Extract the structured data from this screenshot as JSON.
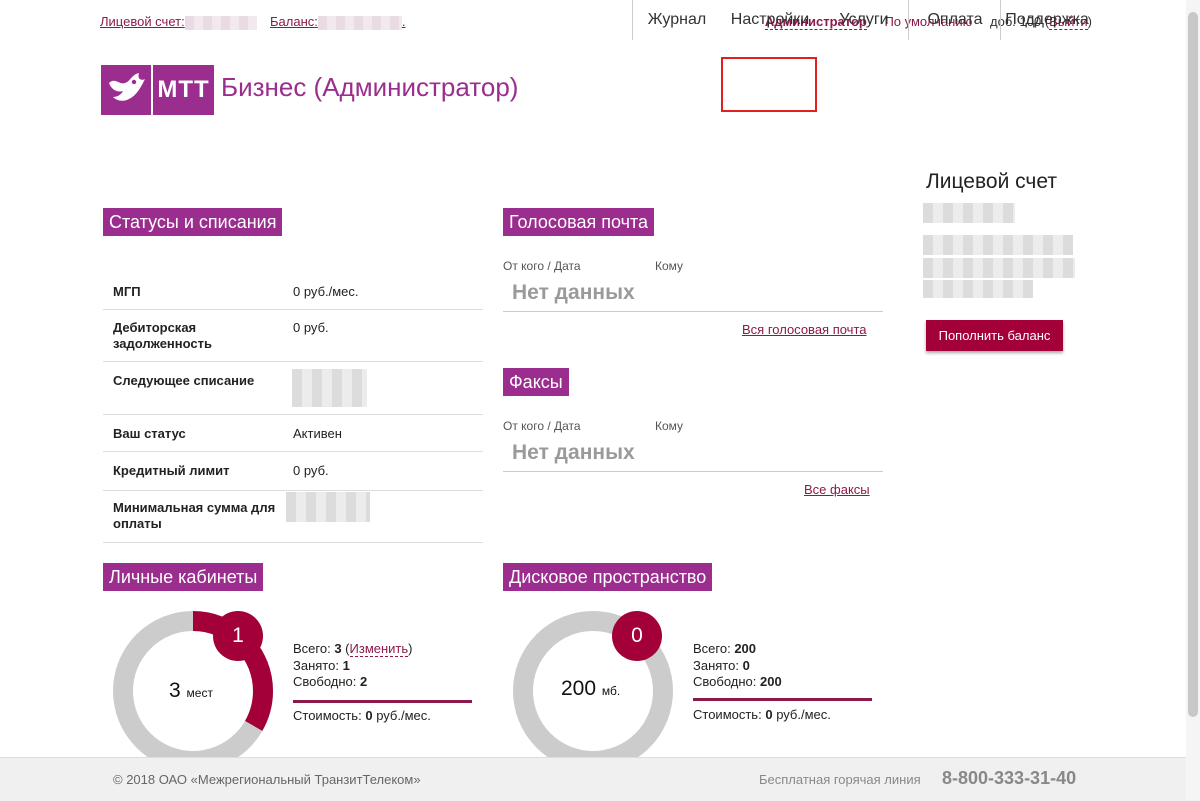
{
  "topbar": {
    "account_label": "Лицевой счет:",
    "balance_label": "Баланс:",
    "balance_suffix": ".",
    "user": "Администратор",
    "profile": "По умолчанию",
    "ext": "доб. 100",
    "logout": "Выйти"
  },
  "header": {
    "logo_text": "МТТ",
    "brand": "Бизнес (Администратор)",
    "nav": [
      {
        "label": "Журнал"
      },
      {
        "label": "Настройки"
      },
      {
        "label": "Услуги"
      },
      {
        "label": "Оплата"
      },
      {
        "label": "Поддержка"
      }
    ]
  },
  "statuses": {
    "title": "Статусы и списания",
    "rows": [
      {
        "k": "МГП",
        "v": "0 руб./мес."
      },
      {
        "k": "Дебиторская задолженность",
        "v": "0 руб."
      },
      {
        "k": "Следующее списание",
        "v": ""
      },
      {
        "k": "Ваш статус",
        "v": "Активен"
      },
      {
        "k": "Кредитный лимит",
        "v": "0 руб."
      },
      {
        "k": "Минимальная сумма для оплаты",
        "v": ""
      }
    ]
  },
  "voicemail": {
    "title": "Голосовая почта",
    "col_from": "От кого / Дата",
    "col_to": "Кому",
    "empty": "Нет данных",
    "all_link": "Вся голосовая почта"
  },
  "faxes": {
    "title": "Факсы",
    "col_from": "От кого / Дата",
    "col_to": "Кому",
    "empty": "Нет данных",
    "all_link": "Все факсы"
  },
  "account": {
    "title": "Лицевой счет",
    "button": "Пополнить баланс"
  },
  "cabinets": {
    "title": "Личные кабинеты",
    "badge": "1",
    "center_value": "3",
    "center_unit": "мест",
    "total_label": "Всего:",
    "total": "3",
    "change_link": "Изменить",
    "busy_label": "Занято:",
    "busy": "1",
    "free_label": "Свободно:",
    "free": "2",
    "cost_label": "Стоимость:",
    "cost_value": "0",
    "cost_unit": "руб./мес.",
    "used_fraction": 0.333,
    "accent": "#a3003a"
  },
  "disk": {
    "title": "Дисковое пространство",
    "badge": "0",
    "center_value": "200",
    "center_unit": "мб.",
    "total_label": "Всего:",
    "total": "200",
    "busy_label": "Занято:",
    "busy": "0",
    "free_label": "Свободно:",
    "free": "200",
    "cost_label": "Стоимость:",
    "cost_value": "0",
    "cost_unit": "руб./мес.",
    "used_fraction": 0.0
  },
  "footer": {
    "copyright": "© 2018 ОАО «Межрегиональный ТранзитТелеком»",
    "hotline": "Бесплатная горячая линия",
    "phone": "8-800-333-31-40"
  }
}
